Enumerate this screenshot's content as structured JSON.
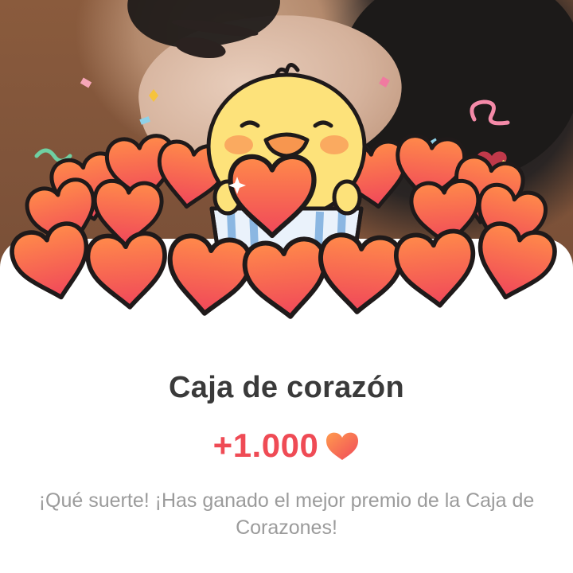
{
  "reward_dialog": {
    "title": "Caja de corazón",
    "amount": "+1.000",
    "message": "¡Qué suerte! ¡Has ganado el mejor premio de la Caja de Corazones!",
    "amount_icon": "heart-icon",
    "illustration": "chick-holding-heart-with-heart-pile"
  },
  "colors": {
    "title_text": "#3a3a3a",
    "amount_text": "#ef4b55",
    "message_text": "#9b9b9b",
    "heart_fill": "#f5604f",
    "chick_fill": "#fde27a"
  }
}
